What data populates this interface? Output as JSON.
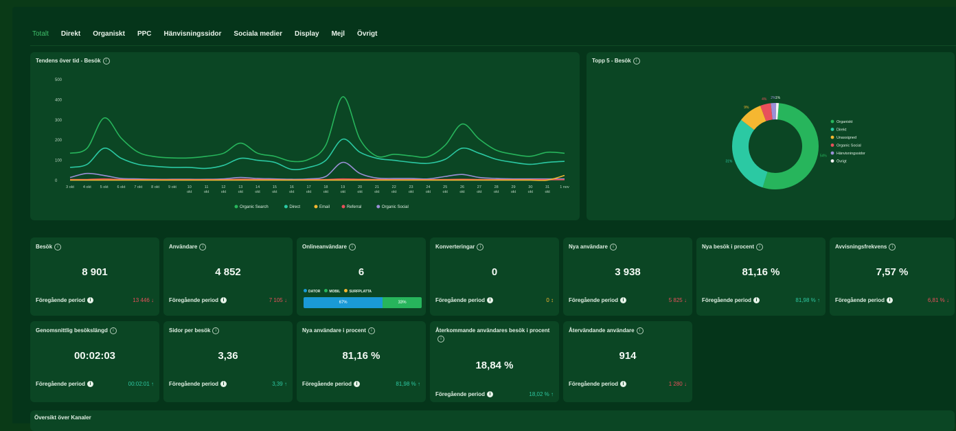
{
  "tabs": [
    "Totalt",
    "Direkt",
    "Organiskt",
    "PPC",
    "Hänvisningssidor",
    "Sociala medier",
    "Display",
    "Mejl",
    "Övrigt"
  ],
  "trend": {
    "title": "Tendens över tid - Besök",
    "yticks": [
      "500",
      "400",
      "300",
      "200",
      "100",
      "0"
    ],
    "xticks": [
      [
        "3 okt",
        ""
      ],
      [
        "4 okt",
        ""
      ],
      [
        "5 okt",
        ""
      ],
      [
        "6 okt",
        ""
      ],
      [
        "7 okt",
        ""
      ],
      [
        "8 okt",
        ""
      ],
      [
        "9 okt",
        ""
      ],
      [
        "10",
        "okt"
      ],
      [
        "11",
        "okt"
      ],
      [
        "12",
        "okt"
      ],
      [
        "13",
        "okt"
      ],
      [
        "14",
        "okt"
      ],
      [
        "15",
        "okt"
      ],
      [
        "16",
        "okt"
      ],
      [
        "17",
        "okt"
      ],
      [
        "18",
        "okt"
      ],
      [
        "19",
        "okt"
      ],
      [
        "20",
        "okt"
      ],
      [
        "21",
        "okt"
      ],
      [
        "22",
        "okt"
      ],
      [
        "23",
        "okt"
      ],
      [
        "24",
        "okt"
      ],
      [
        "25",
        "okt"
      ],
      [
        "26",
        "okt"
      ],
      [
        "27",
        "okt"
      ],
      [
        "28",
        "okt"
      ],
      [
        "29",
        "okt"
      ],
      [
        "30",
        "okt"
      ],
      [
        "31",
        "okt"
      ],
      [
        "1 nov",
        ""
      ]
    ],
    "legend": [
      "Organic Search",
      "Direct",
      "Email",
      "Referral",
      "Organic Social"
    ]
  },
  "donut": {
    "title": "Topp 5 - Besök",
    "legend": [
      "Organiskt",
      "Direkt",
      "Unassigned",
      "Organic Social",
      "Hänvisningssidor",
      "Övrigt"
    ],
    "labels": {
      "organiskt": "54%",
      "direkt": "31%",
      "unassigned": "9%",
      "organic_social": "4%",
      "hanvisning": "2%",
      "ovrigt": "1%"
    }
  },
  "cards": [
    {
      "title": "Besök",
      "value": "8 901",
      "prev_label": "Föregående period",
      "prev": "13 446",
      "trend": "down"
    },
    {
      "title": "Användare",
      "value": "4 852",
      "prev_label": "Föregående period",
      "prev": "7 105",
      "trend": "down"
    },
    {
      "title": "Onlineanvändare",
      "value": "6",
      "device_legend": [
        "DATOR",
        "MOBIL",
        "SURFPLATTA"
      ],
      "device_split": [
        "67%",
        "33%"
      ]
    },
    {
      "title": "Konverteringar",
      "value": "0",
      "prev_label": "Föregående period",
      "prev": "0",
      "trend": "neutral"
    },
    {
      "title": "Nya användare",
      "value": "3 938",
      "prev_label": "Föregående period",
      "prev": "5 825",
      "trend": "down"
    },
    {
      "title": "Nya besök i procent",
      "value": "81,16 %",
      "prev_label": "Föregående period",
      "prev": "81,98 %",
      "trend": "up"
    },
    {
      "title": "Avvisningsfrekvens",
      "value": "7,57 %",
      "prev_label": "Föregående period",
      "prev": "6,81 %",
      "trend": "down"
    },
    {
      "title": "Genomsnittlig besökslängd",
      "value": "00:02:03",
      "prev_label": "Föregående period",
      "prev": "00:02:01",
      "trend": "up"
    },
    {
      "title": "Sidor per besök",
      "value": "3,36",
      "prev_label": "Föregående period",
      "prev": "3,39",
      "trend": "up"
    },
    {
      "title": "Nya användare i procent",
      "value": "81,16 %",
      "prev_label": "Föregående period",
      "prev": "81,98 %",
      "trend": "up"
    },
    {
      "title": "Återkommande användares besök i procent",
      "value": "18,84 %",
      "prev_label": "Föregående period",
      "prev": "18,02 %",
      "trend": "up"
    },
    {
      "title": "Återvändande användare",
      "value": "914",
      "prev_label": "Föregående period",
      "prev": "1 280",
      "trend": "down"
    }
  ],
  "bottom_title": "Översikt över Kanaler",
  "colors": {
    "organic": "#27b55c",
    "direct": "#2bc9a3",
    "email": "#f5b731",
    "referral": "#e8505b",
    "social": "#9b8fd6",
    "other": "#f2f2f2"
  },
  "chart_data": [
    {
      "type": "line",
      "x": [
        "3 okt",
        "4 okt",
        "5 okt",
        "6 okt",
        "7 okt",
        "8 okt",
        "9 okt",
        "10 okt",
        "11 okt",
        "12 okt",
        "13 okt",
        "14 okt",
        "15 okt",
        "16 okt",
        "17 okt",
        "18 okt",
        "19 okt",
        "20 okt",
        "21 okt",
        "22 okt",
        "23 okt",
        "24 okt",
        "25 okt",
        "26 okt",
        "27 okt",
        "28 okt",
        "29 okt",
        "30 okt",
        "31 okt",
        "1 nov"
      ],
      "ylim": [
        0,
        500
      ],
      "series": [
        {
          "name": "Organic Search",
          "values": [
            135,
            160,
            310,
            210,
            140,
            118,
            112,
            112,
            120,
            135,
            185,
            135,
            120,
            95,
            105,
            175,
            415,
            205,
            120,
            130,
            122,
            118,
            175,
            280,
            205,
            150,
            130,
            120,
            140,
            135
          ]
        },
        {
          "name": "Direct",
          "values": [
            65,
            80,
            160,
            110,
            80,
            70,
            65,
            65,
            60,
            75,
            110,
            100,
            90,
            55,
            65,
            100,
            205,
            140,
            110,
            100,
            90,
            85,
            105,
            160,
            135,
            105,
            90,
            80,
            90,
            95
          ]
        },
        {
          "name": "Email",
          "values": [
            2,
            2,
            2,
            2,
            2,
            2,
            2,
            2,
            2,
            2,
            2,
            2,
            2,
            2,
            2,
            2,
            2,
            2,
            2,
            2,
            2,
            2,
            2,
            2,
            2,
            2,
            2,
            2,
            2,
            25
          ]
        },
        {
          "name": "Referral",
          "values": [
            5,
            5,
            8,
            5,
            4,
            4,
            4,
            4,
            4,
            4,
            6,
            5,
            4,
            3,
            4,
            5,
            8,
            6,
            5,
            4,
            4,
            4,
            5,
            6,
            5,
            4,
            4,
            4,
            4,
            4
          ]
        },
        {
          "name": "Organic Social",
          "values": [
            15,
            35,
            25,
            10,
            8,
            6,
            6,
            6,
            6,
            8,
            15,
            10,
            8,
            6,
            8,
            20,
            90,
            35,
            12,
            10,
            10,
            8,
            20,
            30,
            15,
            10,
            8,
            8,
            8,
            8
          ]
        }
      ]
    },
    {
      "type": "pie",
      "categories": [
        "Organiskt",
        "Direkt",
        "Unassigned",
        "Organic Social",
        "Hänvisningssidor",
        "Övrigt"
      ],
      "values": [
        54,
        31,
        9,
        4,
        2,
        1
      ]
    }
  ]
}
